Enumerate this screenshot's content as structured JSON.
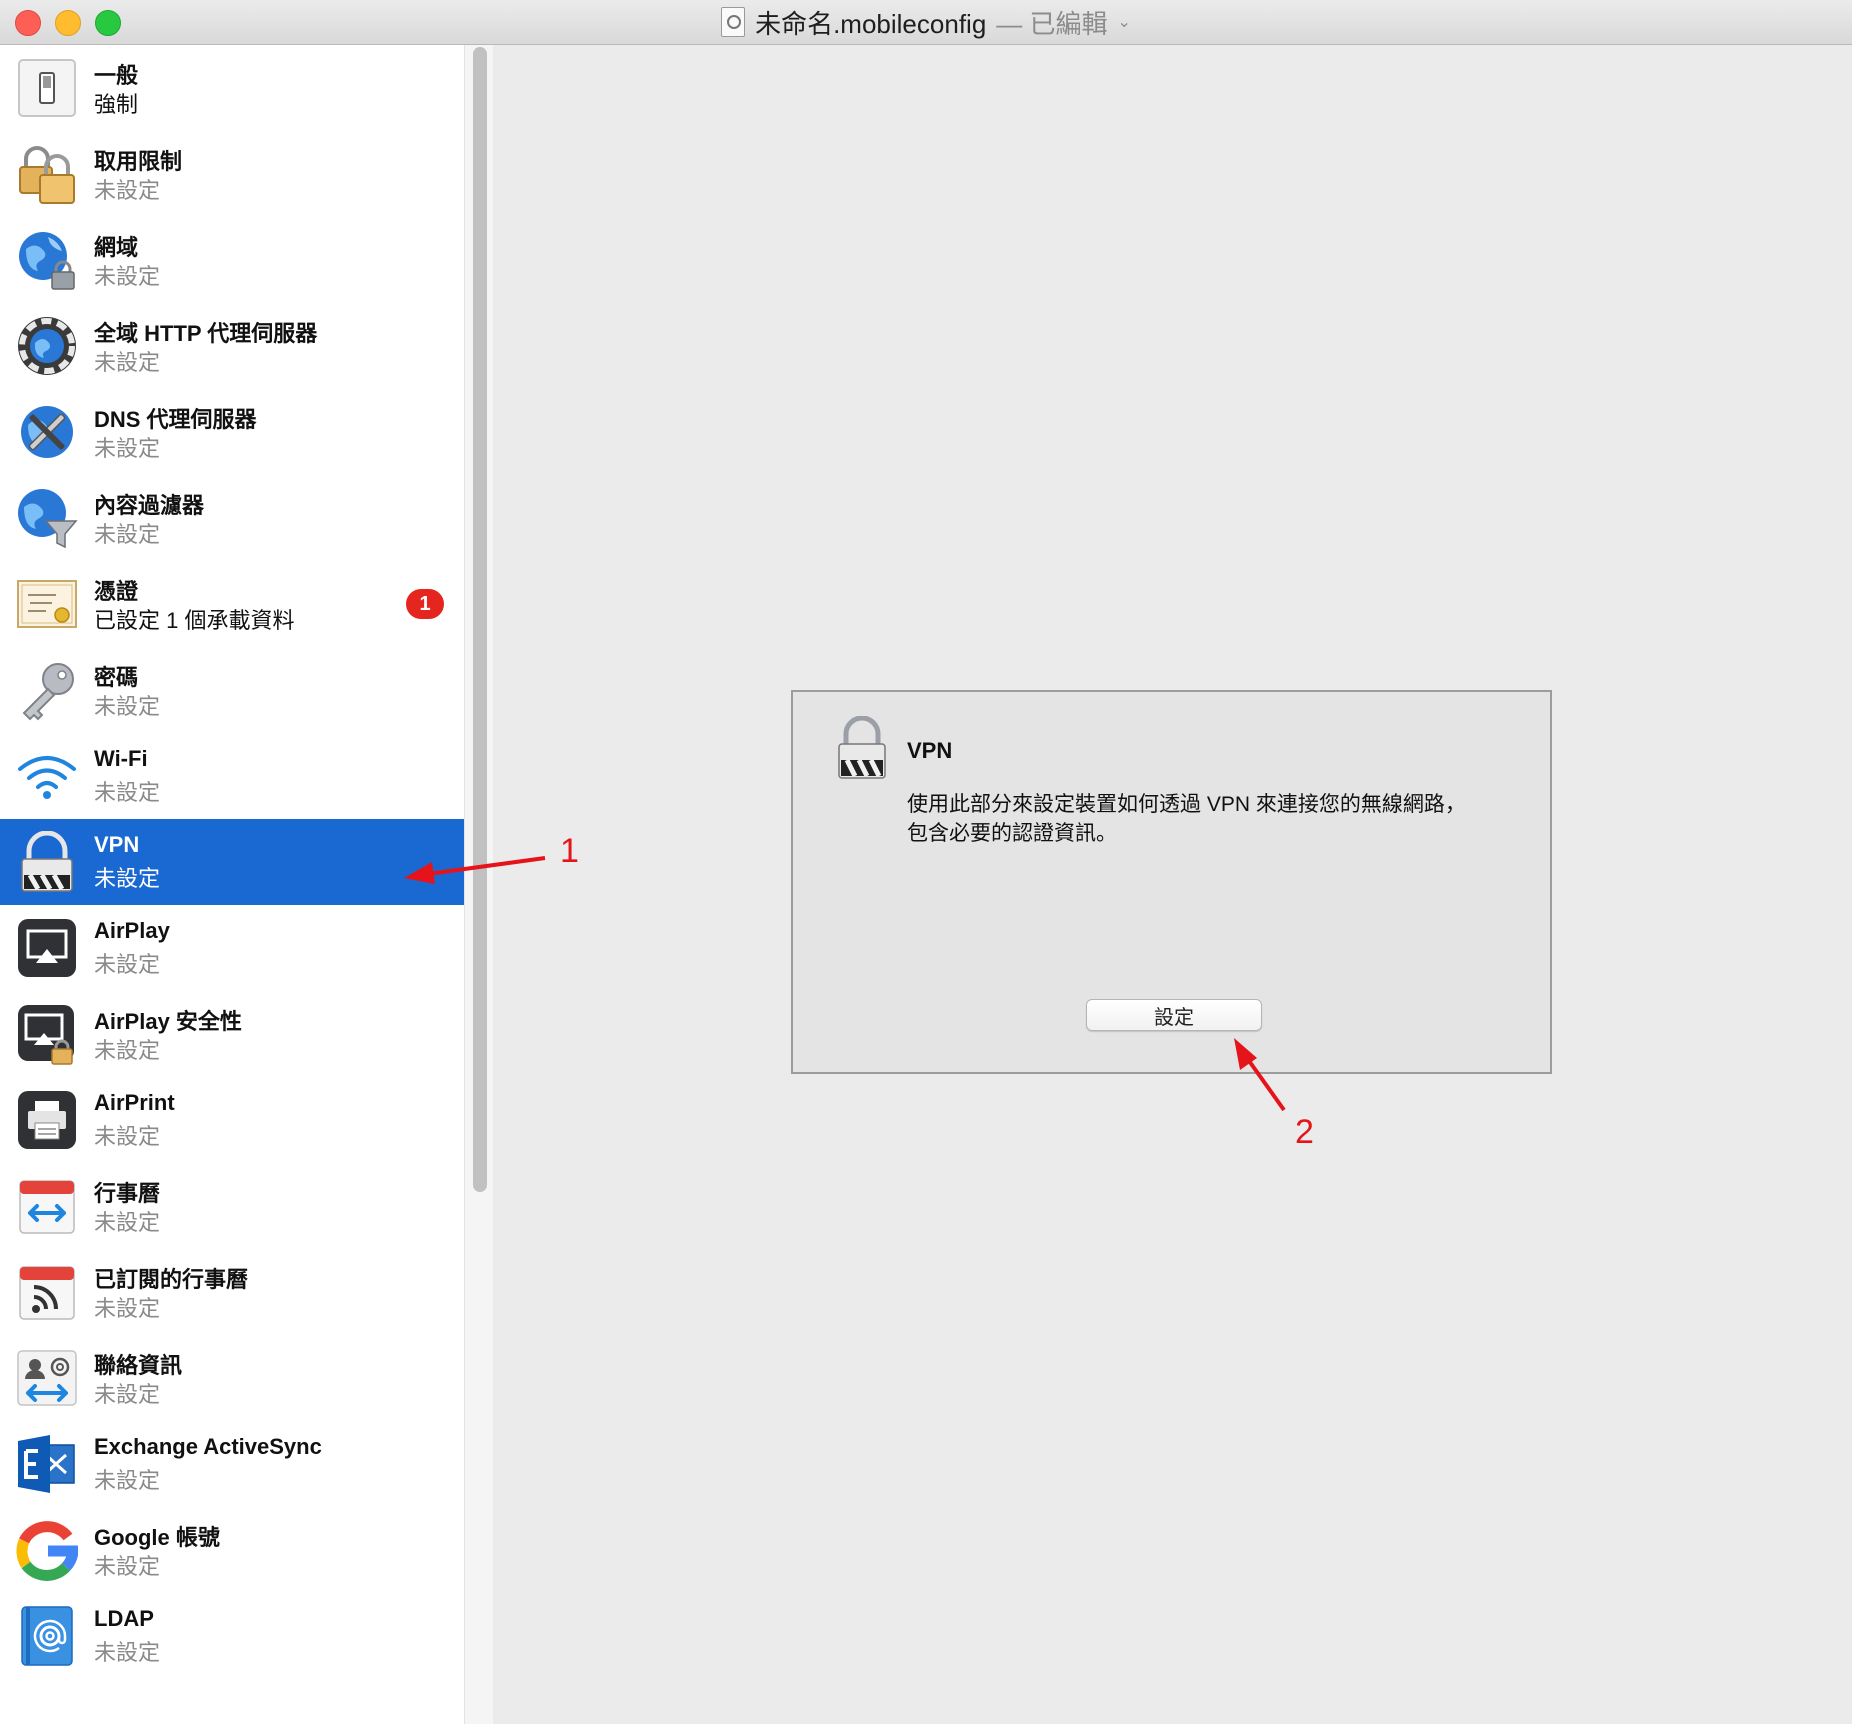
{
  "window": {
    "title": "未命名.mobileconfig",
    "status": "— 已編輯",
    "chevron": "⌄"
  },
  "sidebar": {
    "items": [
      {
        "icon": "switch-icon",
        "label": "一般",
        "status": "強制"
      },
      {
        "icon": "padlocks-icon",
        "label": "取用限制",
        "status": "未設定"
      },
      {
        "icon": "globe-lock-icon",
        "label": "網域",
        "status": "未設定"
      },
      {
        "icon": "globe-proxy-icon",
        "label": "全域 HTTP 代理伺服器",
        "status": "未設定"
      },
      {
        "icon": "globe-tools-icon",
        "label": "DNS 代理伺服器",
        "status": "未設定"
      },
      {
        "icon": "globe-filter-icon",
        "label": "內容過濾器",
        "status": "未設定"
      },
      {
        "icon": "certificate-icon",
        "label": "憑證",
        "status": "已設定 1 個承載資料",
        "badge": "1"
      },
      {
        "icon": "key-icon",
        "label": "密碼",
        "status": "未設定"
      },
      {
        "icon": "wifi-icon",
        "label": "Wi-Fi",
        "status": "未設定"
      },
      {
        "icon": "vpn-lock-icon",
        "label": "VPN",
        "status": "未設定",
        "selected": true
      },
      {
        "icon": "airplay-icon",
        "label": "AirPlay",
        "status": "未設定"
      },
      {
        "icon": "airplay-security-icon",
        "label": "AirPlay 安全性",
        "status": "未設定"
      },
      {
        "icon": "printer-icon",
        "label": "AirPrint",
        "status": "未設定"
      },
      {
        "icon": "calendar-sync-icon",
        "label": "行事曆",
        "status": "未設定"
      },
      {
        "icon": "calendar-subscribe-icon",
        "label": "已訂閱的行事曆",
        "status": "未設定"
      },
      {
        "icon": "contacts-icon",
        "label": "聯絡資訊",
        "status": "未設定"
      },
      {
        "icon": "exchange-icon",
        "label": "Exchange ActiveSync",
        "status": "未設定"
      },
      {
        "icon": "google-icon",
        "label": "Google 帳號",
        "status": "未設定"
      },
      {
        "icon": "ldap-icon",
        "label": "LDAP",
        "status": "未設定"
      }
    ]
  },
  "panel": {
    "icon": "vpn-lock-icon",
    "title": "VPN",
    "description_line1": "使用此部分來設定裝置如何透過 VPN 來連接您的無線網路，",
    "description_line2": "包含必要的認證資訊。",
    "button_label": "設定"
  },
  "annotations": {
    "color": "#e5141a",
    "marker1": "1",
    "marker2": "2"
  },
  "colors": {
    "selection": "#1a68d2",
    "badge": "#e5261e"
  }
}
